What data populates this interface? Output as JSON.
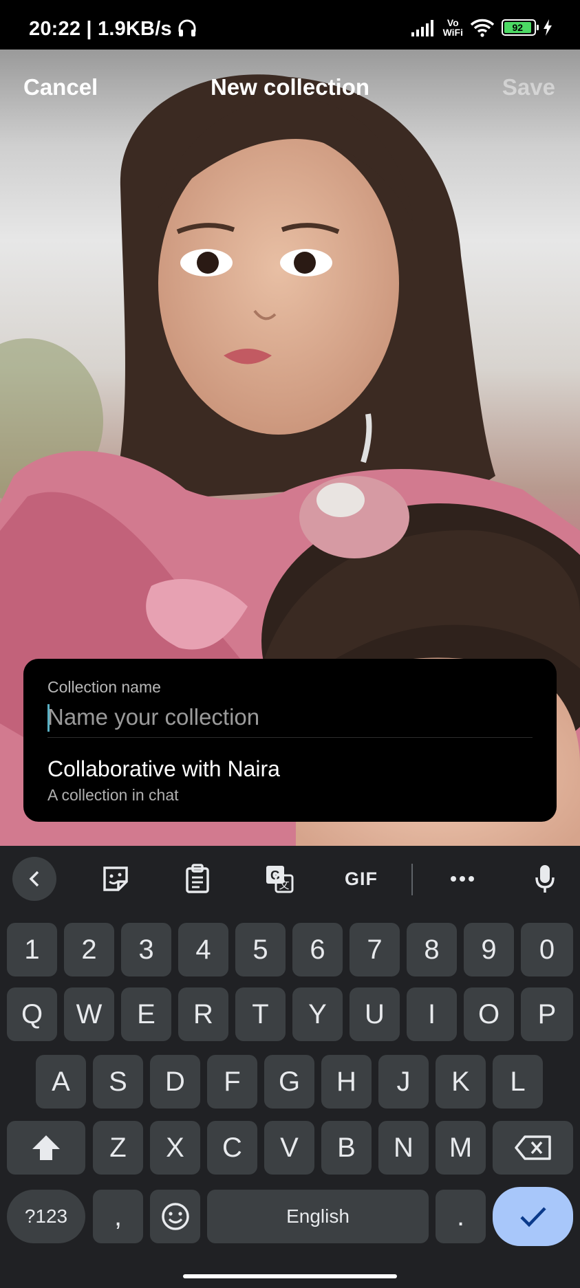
{
  "status_bar": {
    "time": "20:22",
    "speed": "1.9KB/s",
    "vowifi_top": "Vo",
    "vowifi_bottom": "WiFi",
    "battery_level": 92,
    "battery_label": "92",
    "icons": [
      "headphones-icon",
      "signal-icon",
      "wifi-icon",
      "battery-icon",
      "charging-icon"
    ]
  },
  "header": {
    "cancel_label": "Cancel",
    "title": "New collection",
    "save_label": "Save"
  },
  "form": {
    "field_label": "Collection name",
    "placeholder": "Name your collection",
    "value": "",
    "collab_title": "Collaborative with Naira",
    "collab_subtitle": "A collection in chat"
  },
  "keyboard": {
    "toolbar": [
      "back-icon",
      "sticker-icon",
      "clipboard-icon",
      "translate-icon",
      "gif",
      "more-icon",
      "mic-icon"
    ],
    "gif_label": "GIF",
    "more_label": "•••",
    "row_numbers": [
      "1",
      "2",
      "3",
      "4",
      "5",
      "6",
      "7",
      "8",
      "9",
      "0"
    ],
    "row1": [
      "Q",
      "W",
      "E",
      "R",
      "T",
      "Y",
      "U",
      "I",
      "O",
      "P"
    ],
    "row2": [
      "A",
      "S",
      "D",
      "F",
      "G",
      "H",
      "J",
      "K",
      "L"
    ],
    "row3": [
      "Z",
      "X",
      "C",
      "V",
      "B",
      "N",
      "M"
    ],
    "symbols_label": "?123",
    "comma_label": ",",
    "space_label": "English",
    "period_label": "."
  },
  "colors": {
    "accent_enter": "#a8c7fa",
    "keyboard_bg": "#202124",
    "key_bg": "#3c4043",
    "caret": "#5ab0c4"
  }
}
